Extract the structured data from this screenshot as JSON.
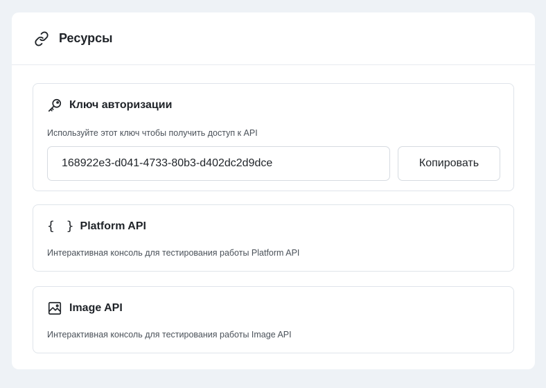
{
  "header": {
    "title": "Ресурсы",
    "icon": "link-icon"
  },
  "auth_key_card": {
    "icon": "key-icon",
    "title": "Ключ авторизации",
    "description": "Используйте этот ключ чтобы получить доступ к API",
    "key_value": "168922e3-d041-4733-80b3-d402dc2d9dce",
    "copy_label": "Копировать"
  },
  "platform_api_card": {
    "icon": "braces-icon",
    "icon_glyph": "{ }",
    "title": "Platform API",
    "description": "Интерактивная консоль для тестирования работы Platform API"
  },
  "image_api_card": {
    "icon": "image-icon",
    "title": "Image API",
    "description": "Интерактивная консоль для тестирования работы Image API"
  }
}
